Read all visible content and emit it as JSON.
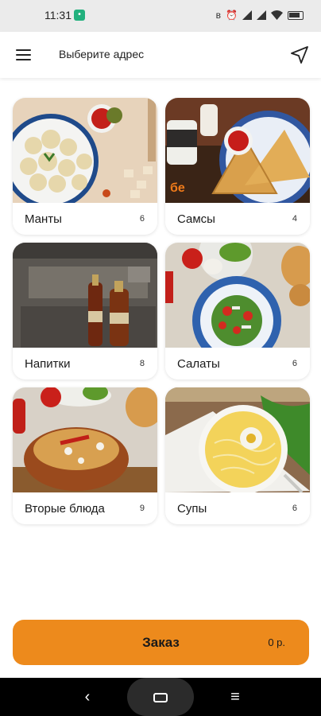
{
  "status_bar": {
    "time": "11:31",
    "app_badge": ""
  },
  "app_bar": {
    "address_prompt": "Выберите адрес"
  },
  "categories": [
    {
      "name": "Манты",
      "count": "6"
    },
    {
      "name": "Самсы",
      "count": "4"
    },
    {
      "name": "Напитки",
      "count": "8"
    },
    {
      "name": "Салаты",
      "count": "6"
    },
    {
      "name": "Вторые блюда",
      "count": "9"
    },
    {
      "name": "Супы",
      "count": "6"
    }
  ],
  "order": {
    "label": "Заказ",
    "total": "0 р."
  },
  "colors": {
    "accent": "#ed8a1c"
  }
}
